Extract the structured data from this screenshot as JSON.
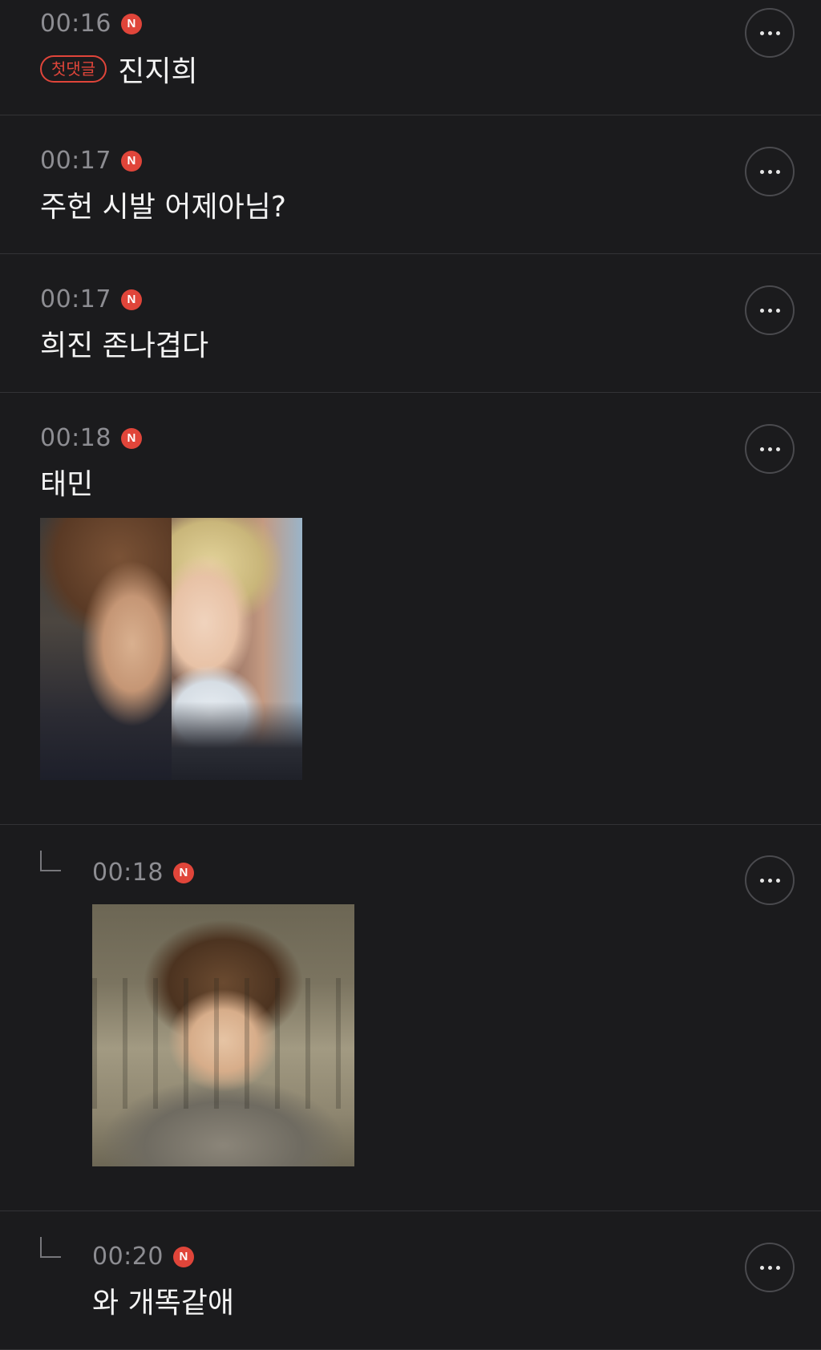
{
  "comments": [
    {
      "time": "00:16",
      "new": "N",
      "badge": "첫댓글",
      "text": "진지희"
    },
    {
      "time": "00:17",
      "new": "N",
      "text": "주헌 시발 어제아님?"
    },
    {
      "time": "00:17",
      "new": "N",
      "text": "희진 존나겹다"
    },
    {
      "time": "00:18",
      "new": "N",
      "text": "태민"
    },
    {
      "time": "00:18",
      "new": "N",
      "reply": true
    },
    {
      "time": "00:20",
      "new": "N",
      "reply": true,
      "text": "와 개똑같애"
    }
  ],
  "colors": {
    "accent": "#e0453a",
    "background": "#1b1b1d",
    "time": "#8d8d92"
  },
  "icons": {
    "more": "more-horizontal-icon",
    "reply": "reply-arrow-icon",
    "new": "new-badge-icon"
  }
}
